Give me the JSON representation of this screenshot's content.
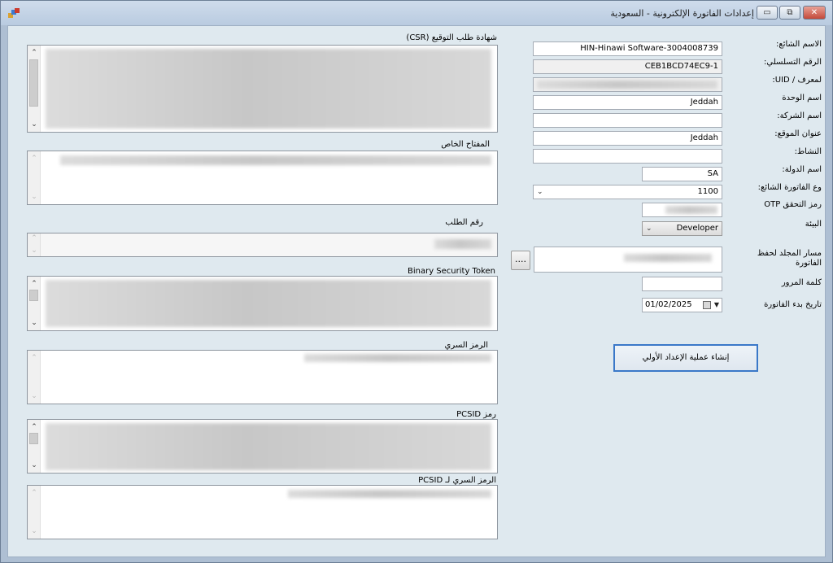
{
  "window": {
    "title": "إعدادات الفاتورة الإلكترونية - السعودية",
    "controls": {
      "minimize": "▭",
      "restore": "⧉",
      "close": "✕"
    }
  },
  "form": {
    "common_name": {
      "label": "الاسم الشائع:",
      "value": "HIN-Hinawi Software-3004008739"
    },
    "serial_number": {
      "label": "الرقم التسلسلي:",
      "value": "CEB1BCD74EC9-1"
    },
    "uid": {
      "label": "لمعرف / UID:",
      "value": ""
    },
    "unit_name": {
      "label": "اسم الوحدة",
      "value": "Jeddah"
    },
    "company_name": {
      "label": "اسم الشركة:",
      "value": ""
    },
    "location_address": {
      "label": "عنوان الموقع:",
      "value": "Jeddah"
    },
    "activity": {
      "label": "النشاط:",
      "value": ""
    },
    "country_name": {
      "label": "اسم الدولة:",
      "value": "SA"
    },
    "invoice_type": {
      "label": "وع الفاتورة الشائع:",
      "value": "1100"
    },
    "otp": {
      "label": "رمز التحقق OTP",
      "value": ""
    },
    "environment": {
      "label": "البيئة",
      "value": "Developer"
    },
    "folder_path": {
      "label": "مسار المجلد لحفظ الفاتورة",
      "value": "",
      "browse": "...."
    },
    "password": {
      "label": "كلمة المرور",
      "value": ""
    },
    "invoice_start_date": {
      "label": "تاريخ بدء الفاتورة",
      "value": "01/02/2025"
    },
    "create_button": "إنشاء عملية الإعداد الأولي"
  },
  "panels": {
    "csr": {
      "label": "شهادة طلب التوقيع (CSR)"
    },
    "private_key": {
      "label": "المفتاح الخاص"
    },
    "request_number": {
      "label": "رقم الطلب"
    },
    "binary_security_token": {
      "label": "Binary Security Token"
    },
    "secret": {
      "label": "الرمز السري"
    },
    "pcsid": {
      "label": "رمز PCSID"
    },
    "pcsid_secret": {
      "label": "الرمز السري لـ PCSID"
    }
  },
  "icons": [
    "app-icon",
    "chevron-up-icon",
    "chevron-down-icon",
    "calendar-icon"
  ],
  "colors": {
    "accent": "#3a78c8",
    "client_bg": "#dfe9ef",
    "titlebar": "#c3d3e6"
  }
}
